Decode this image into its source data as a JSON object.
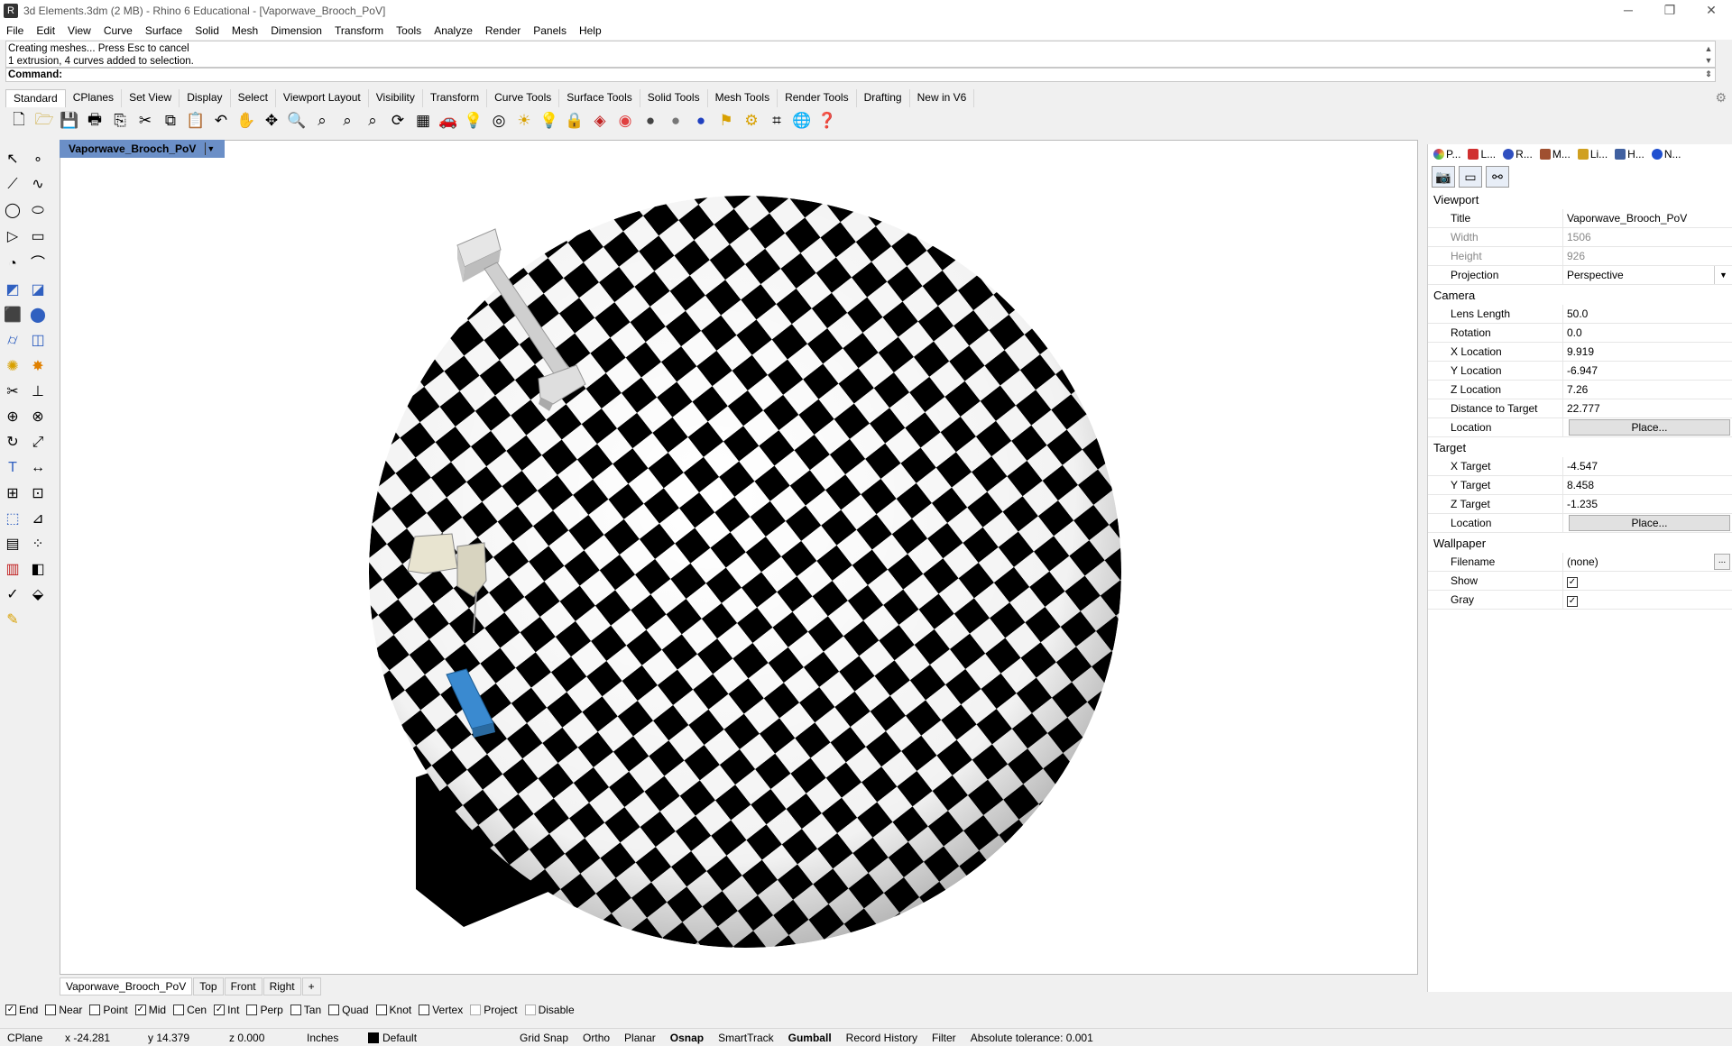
{
  "window": {
    "title": "3d Elements.3dm (2 MB) - Rhino 6 Educational - [Vaporwave_Brooch_PoV]",
    "min": "─",
    "max": "❐",
    "close": "✕"
  },
  "menu": [
    "File",
    "Edit",
    "View",
    "Curve",
    "Surface",
    "Solid",
    "Mesh",
    "Dimension",
    "Transform",
    "Tools",
    "Analyze",
    "Render",
    "Panels",
    "Help"
  ],
  "command": {
    "history_line1": "Creating meshes... Press Esc to cancel",
    "history_line2": "1 extrusion, 4 curves added to selection.",
    "prompt": "Command:"
  },
  "toolbar_tabs": [
    "Standard",
    "CPlanes",
    "Set View",
    "Display",
    "Select",
    "Viewport Layout",
    "Visibility",
    "Transform",
    "Curve Tools",
    "Surface Tools",
    "Solid Tools",
    "Mesh Tools",
    "Render Tools",
    "Drafting",
    "New in V6"
  ],
  "toolbar_icons": [
    "new-icon",
    "open-icon",
    "save-icon",
    "print-icon",
    "import-icon",
    "cut-icon",
    "copy-icon",
    "paste-icon",
    "undo-icon",
    "pan-hand-icon",
    "move-icon",
    "zoom-icon",
    "zoom-window-icon",
    "zoom-extents-icon",
    "zoom-selected-icon",
    "rotate-view-icon",
    "grid-icon",
    "car-icon",
    "lamp-icon",
    "target-icon",
    "light-icon",
    "bulb-icon",
    "lock-icon",
    "material-icon",
    "color-wheel-icon",
    "sphere-shaded-icon",
    "sphere-render-icon",
    "sphere-blue-icon",
    "flag-icon",
    "gear-icon",
    "options-icon",
    "globe-icon",
    "help-icon"
  ],
  "viewport": {
    "title": "Vaporwave_Brooch_PoV",
    "tabs": [
      "Vaporwave_Brooch_PoV",
      "Top",
      "Front",
      "Right"
    ],
    "add_tab": "+"
  },
  "osnap": [
    {
      "label": "End",
      "checked": true
    },
    {
      "label": "Near",
      "checked": false
    },
    {
      "label": "Point",
      "checked": false
    },
    {
      "label": "Mid",
      "checked": true
    },
    {
      "label": "Cen",
      "checked": false
    },
    {
      "label": "Int",
      "checked": true
    },
    {
      "label": "Perp",
      "checked": false
    },
    {
      "label": "Tan",
      "checked": false
    },
    {
      "label": "Quad",
      "checked": false
    },
    {
      "label": "Knot",
      "checked": false
    },
    {
      "label": "Vertex",
      "checked": false
    },
    {
      "label": "Project",
      "checked": false,
      "disabled": true
    },
    {
      "label": "Disable",
      "checked": false,
      "disabled": true
    }
  ],
  "status": {
    "cplane": "CPlane",
    "x": "x -24.281",
    "y": "y 14.379",
    "z": "z 0.000",
    "units": "Inches",
    "layer": "Default",
    "grid_snap": "Grid Snap",
    "ortho": "Ortho",
    "planar": "Planar",
    "osnap": "Osnap",
    "smarttrack": "SmartTrack",
    "gumball": "Gumball",
    "record_history": "Record History",
    "filter": "Filter",
    "tolerance": "Absolute tolerance: 0.001"
  },
  "panel": {
    "tabs": [
      {
        "label": "P...",
        "color": "#e04040"
      },
      {
        "label": "L...",
        "color": "#d03030"
      },
      {
        "label": "R...",
        "color": "#3050c0"
      },
      {
        "label": "M...",
        "color": "#a05030"
      },
      {
        "label": "Li...",
        "color": "#d0a020"
      },
      {
        "label": "H...",
        "color": "#4060a0"
      },
      {
        "label": "N...",
        "color": "#2050d0"
      }
    ],
    "viewport_section": "Viewport",
    "camera_section": "Camera",
    "target_section": "Target",
    "wallpaper_section": "Wallpaper",
    "viewport": {
      "title_k": "Title",
      "title_v": "Vaporwave_Brooch_PoV",
      "width_k": "Width",
      "width_v": "1506",
      "height_k": "Height",
      "height_v": "926",
      "projection_k": "Projection",
      "projection_v": "Perspective"
    },
    "camera": {
      "lens_k": "Lens Length",
      "lens_v": "50.0",
      "rotation_k": "Rotation",
      "rotation_v": "0.0",
      "xloc_k": "X Location",
      "xloc_v": "9.919",
      "yloc_k": "Y Location",
      "yloc_v": "-6.947",
      "zloc_k": "Z Location",
      "zloc_v": "7.26",
      "dist_k": "Distance to Target",
      "dist_v": "22.777",
      "loc_k": "Location",
      "loc_btn": "Place..."
    },
    "target": {
      "x_k": "X Target",
      "x_v": "-4.547",
      "y_k": "Y Target",
      "y_v": "8.458",
      "z_k": "Z Target",
      "z_v": "-1.235",
      "loc_k": "Location",
      "loc_btn": "Place..."
    },
    "wallpaper": {
      "file_k": "Filename",
      "file_v": "(none)",
      "file_btn": "...",
      "show_k": "Show",
      "gray_k": "Gray"
    }
  },
  "colors": {
    "viewport_tab": "#6b8fc7",
    "checker_dark": "#000000",
    "checker_light": "#ffffff"
  }
}
